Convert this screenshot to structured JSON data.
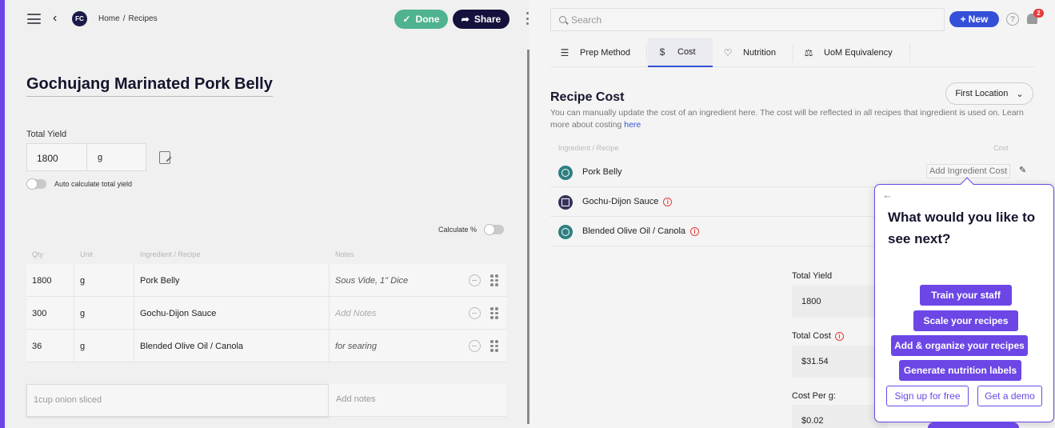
{
  "header": {
    "avatar_initials": "FC",
    "breadcrumb": [
      "Home",
      "/",
      "Recipes"
    ],
    "done_label": "Done",
    "share_label": "Share"
  },
  "recipe": {
    "title": "Gochujang Marinated Pork Belly",
    "total_yield_label": "Total Yield",
    "yield_qty": "1800",
    "yield_unit": "g",
    "auto_calc_label": "Auto calculate total yield",
    "calc_pct_label": "Calculate %",
    "columns": [
      "Qty",
      "Unit",
      "Ingredient / Recipe",
      "Notes"
    ],
    "ingredients": [
      {
        "qty": "1800",
        "unit": "g",
        "name": "Pork Belly",
        "notes": "Sous Vide, 1\" Dice",
        "notes_placeholder": false
      },
      {
        "qty": "300",
        "unit": "g",
        "name": "Gochu-Dijon Sauce",
        "notes": "Add Notes",
        "notes_placeholder": true
      },
      {
        "qty": "36",
        "unit": "g",
        "name": "Blended Olive Oil / Canola",
        "notes": "for searing",
        "notes_placeholder": false
      }
    ],
    "new_ingredient_placeholder": "1cup onion sliced",
    "new_notes_placeholder": "Add notes"
  },
  "topright": {
    "search_placeholder": "Search",
    "new_label": "New",
    "notification_count": "2"
  },
  "tabs": [
    {
      "label": "Prep Method",
      "icon": "list-icon",
      "active": false
    },
    {
      "label": "Cost",
      "icon": "dollar-icon",
      "active": true
    },
    {
      "label": "Nutrition",
      "icon": "heart-icon",
      "active": false
    },
    {
      "label": "UoM Equivalency",
      "icon": "scale-icon",
      "active": false
    }
  ],
  "cost": {
    "title": "Recipe Cost",
    "location": "First Location",
    "description": "You can manually update the cost of an ingredient here. The cost will be reflected in all recipes that ingredient is used on. Learn more about costing",
    "description_link": "here",
    "col_left": "Ingredient / Recipe",
    "col_right": "Cost",
    "rows": [
      {
        "name": "Pork Belly",
        "type": "ingredient",
        "warning": false,
        "action": "Add Ingredient Cost"
      },
      {
        "name": "Gochu-Dijon Sauce",
        "type": "recipe",
        "warning": true
      },
      {
        "name": "Blended Olive Oil / Canola",
        "type": "ingredient",
        "warning": true
      }
    ],
    "total_yield_label": "Total Yield",
    "total_yield_value": "1800",
    "total_cost_label": "Total Cost",
    "total_cost_value": "$31.54",
    "cost_per_label": "Cost Per g:",
    "cost_per_value": "$0.02"
  },
  "popup": {
    "heading": "What would you like to see next?",
    "buttons": [
      "Train your staff",
      "Scale your recipes",
      "Add & organize your recipes",
      "Generate nutrition labels"
    ],
    "signup_label": "Sign up for free",
    "demo_label": "Get a demo"
  },
  "colors": {
    "accent": "#6c47e6",
    "done_green": "#4fb38f",
    "navy": "#14123d",
    "blue": "#3550d8",
    "alert_red": "#e53b3b"
  }
}
